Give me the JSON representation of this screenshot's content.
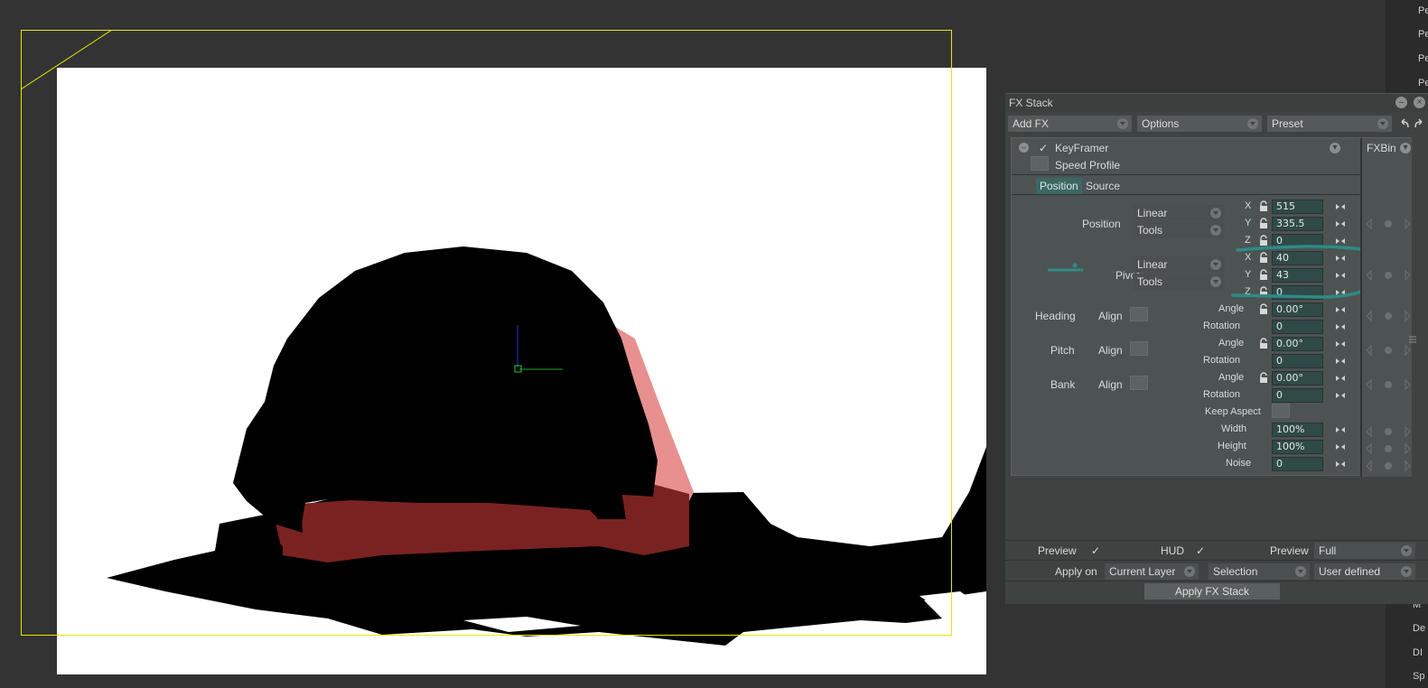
{
  "right_strip": {
    "top_items": [
      "Pe",
      "Pe",
      "Pe",
      "Pe"
    ],
    "bottom_items": [
      "M",
      "De",
      "DI",
      "Sp"
    ]
  },
  "fx_stack": {
    "title": "FX Stack",
    "toolbar": {
      "add_fx": "Add FX",
      "options": "Options",
      "preset": "Preset"
    },
    "effect": {
      "name": "KeyFramer",
      "speed_profile_label": "Speed Profile",
      "fxbin_label": "FXBin",
      "tabs": [
        "Position",
        "Source"
      ],
      "position": {
        "label": "Position",
        "interp": "Linear",
        "mode": "Tools",
        "x": "515",
        "y": "335.5",
        "z": "0"
      },
      "pivot": {
        "label": "Pivot",
        "interp": "Linear",
        "mode": "Tools",
        "x": "40",
        "y": "43",
        "z": "0"
      },
      "axes": [
        "X",
        "Y",
        "Z"
      ],
      "rotations": [
        {
          "label": "Heading",
          "align": "Align",
          "angle_label": "Angle",
          "angle": "0.00°",
          "rotation_label": "Rotation",
          "rotation": "0"
        },
        {
          "label": "Pitch",
          "align": "Align",
          "angle_label": "Angle",
          "angle": "0.00°",
          "rotation_label": "Rotation",
          "rotation": "0"
        },
        {
          "label": "Bank",
          "align": "Align",
          "angle_label": "Angle",
          "angle": "0.00°",
          "rotation_label": "Rotation",
          "rotation": "0"
        }
      ],
      "keep_aspect_label": "Keep Aspect",
      "width_label": "Width",
      "width": "100%",
      "height_label": "Height",
      "height": "100%",
      "noise_label": "Noise",
      "noise": "0"
    },
    "bottom": {
      "preview_label": "Preview",
      "hud_label": "HUD",
      "preview2_label": "Preview",
      "preview_quality": "Full",
      "apply_on_label": "Apply on",
      "apply_on_layer": "Current Layer",
      "apply_on_selection": "Selection",
      "apply_on_user": "User defined",
      "apply_button": "Apply FX Stack",
      "check_mark": "✓"
    }
  },
  "colors": {
    "frame": "#e8e800",
    "silhouette": "#000000",
    "red_dark": "#7a2222",
    "red_light": "#e89090",
    "annotation": "#2f8a86",
    "panel_bg": "#4c5352",
    "field_bg": "#2f4a47"
  }
}
